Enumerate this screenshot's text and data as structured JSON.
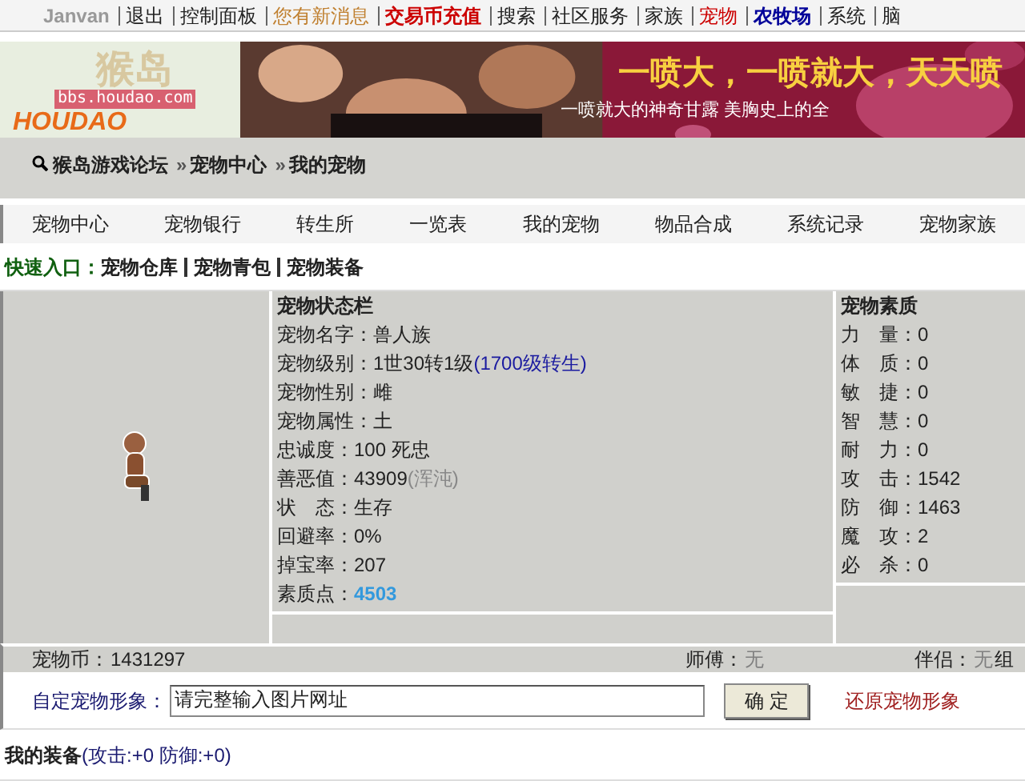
{
  "top_nav": {
    "user": "Janvan",
    "items": [
      {
        "label": "退出",
        "kind": "plain"
      },
      {
        "label": "控制面板",
        "kind": "plain"
      },
      {
        "label": "您有新消息",
        "kind": "notice"
      },
      {
        "label": "交易币充值",
        "kind": "hot"
      },
      {
        "label": "搜索",
        "kind": "plain"
      },
      {
        "label": "社区服务",
        "kind": "plain"
      },
      {
        "label": "家族",
        "kind": "plain"
      },
      {
        "label": "宠物",
        "kind": "pet"
      },
      {
        "label": "农牧场",
        "kind": "farm"
      },
      {
        "label": "系统",
        "kind": "plain"
      },
      {
        "label": "脑",
        "kind": "plain"
      }
    ]
  },
  "logo": {
    "name": "猴岛",
    "url": "bbs.houdao.com",
    "wordmark": "HOUDAO"
  },
  "banner": {
    "headline": "一喷大，一喷就大，天天喷",
    "subline": "一喷就大的神奇甘露 美胸史上的全"
  },
  "breadcrumb": {
    "separator": "»",
    "items": [
      "猴岛游戏论坛",
      "宠物中心",
      "我的宠物"
    ]
  },
  "tabs": [
    "宠物中心",
    "宠物银行",
    "转生所",
    "一览表",
    "我的宠物",
    "物品合成",
    "系统记录",
    "宠物家族"
  ],
  "quick_links": {
    "label": "快速入口：",
    "items": [
      "宠物仓库",
      "宠物青包",
      "宠物装备"
    ]
  },
  "status": {
    "title": "宠物状态栏",
    "rows": [
      {
        "label": "宠物名字：",
        "value": "兽人族",
        "kind": "plain"
      },
      {
        "label": "宠物级别：",
        "value": "1世30转1级",
        "note": "(1700级转生)",
        "note_muted": false,
        "kind": "plain"
      },
      {
        "label": "宠物性别：",
        "value": "雌",
        "kind": "plain"
      },
      {
        "label": "宠物属性：",
        "value": "土",
        "kind": "plain"
      },
      {
        "label": "忠诚度：",
        "value": "100 死忠",
        "kind": "plain"
      },
      {
        "label": "善恶值：",
        "value": "43909",
        "note": "(浑沌)",
        "note_muted": true,
        "kind": "plain"
      },
      {
        "label": "状　态：",
        "value": "生存",
        "kind": "plain"
      },
      {
        "label": "回避率：",
        "value": "0%",
        "kind": "plain"
      },
      {
        "label": "掉宝率：",
        "value": "207",
        "kind": "plain"
      },
      {
        "label": "素质点：",
        "value": "4503",
        "kind": "highlight"
      }
    ]
  },
  "qualities": {
    "title": "宠物素质",
    "rows": [
      {
        "label": "力　量：",
        "value": "0"
      },
      {
        "label": "体　质：",
        "value": "0"
      },
      {
        "label": "敏　捷：",
        "value": "0"
      },
      {
        "label": "智　慧：",
        "value": "0"
      },
      {
        "label": "耐　力：",
        "value": "0"
      },
      {
        "label": "攻　击：",
        "value": "1542"
      },
      {
        "label": "防　御：",
        "value": "1463"
      },
      {
        "label": "魔　攻：",
        "value": "2"
      },
      {
        "label": "必　杀：",
        "value": "0"
      }
    ]
  },
  "info_bar": [
    {
      "label": "宠物币：",
      "value": "1431297",
      "muted": false
    },
    {
      "label": "师傅：",
      "value": "无",
      "muted": true
    },
    {
      "label": "伴侣：",
      "value": "无",
      "muted": true
    },
    {
      "label": "组"
    }
  ],
  "custom_image": {
    "label": "自定宠物形象：",
    "value": "请完整输入图片网址",
    "button": "确 定",
    "reset": "还原宠物形象"
  },
  "equipment": {
    "title": "我的装备",
    "stats": "(攻击:+0 防御:+0)"
  }
}
